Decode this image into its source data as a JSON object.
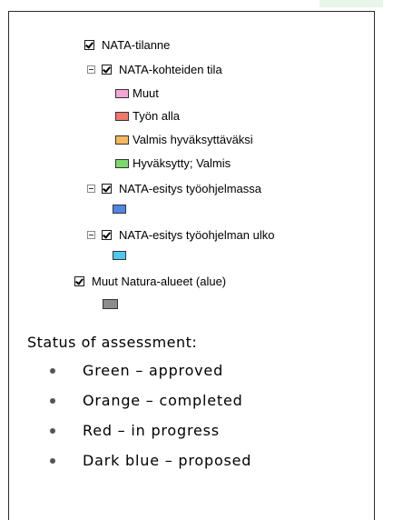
{
  "legend": {
    "layers": [
      {
        "label": "NATA-tilanne"
      },
      {
        "label": "NATA-kohteiden tila",
        "items": [
          {
            "label": "Muut",
            "color": "#f7a6d8"
          },
          {
            "label": "Työn alla",
            "color": "#f0776a"
          },
          {
            "label": "Valmis hyväksyttäväksi",
            "color": "#f5b85c"
          },
          {
            "label": "Hyväksytty; Valmis",
            "color": "#7ad96b"
          }
        ]
      },
      {
        "label": "NATA-esitys työohjelmassa",
        "swatch_color": "#4f86e8"
      },
      {
        "label": "NATA-esitys työohjelman ulko",
        "swatch_color": "#4fc8ef"
      },
      {
        "label": "Muut Natura-alueet (alue)",
        "swatch_color": "#8c8c8c"
      }
    ]
  },
  "status": {
    "title": "Status of assessment:",
    "items": [
      "Green – approved",
      "Orange – completed",
      "Red – in progress",
      "Dark blue – proposed"
    ]
  }
}
